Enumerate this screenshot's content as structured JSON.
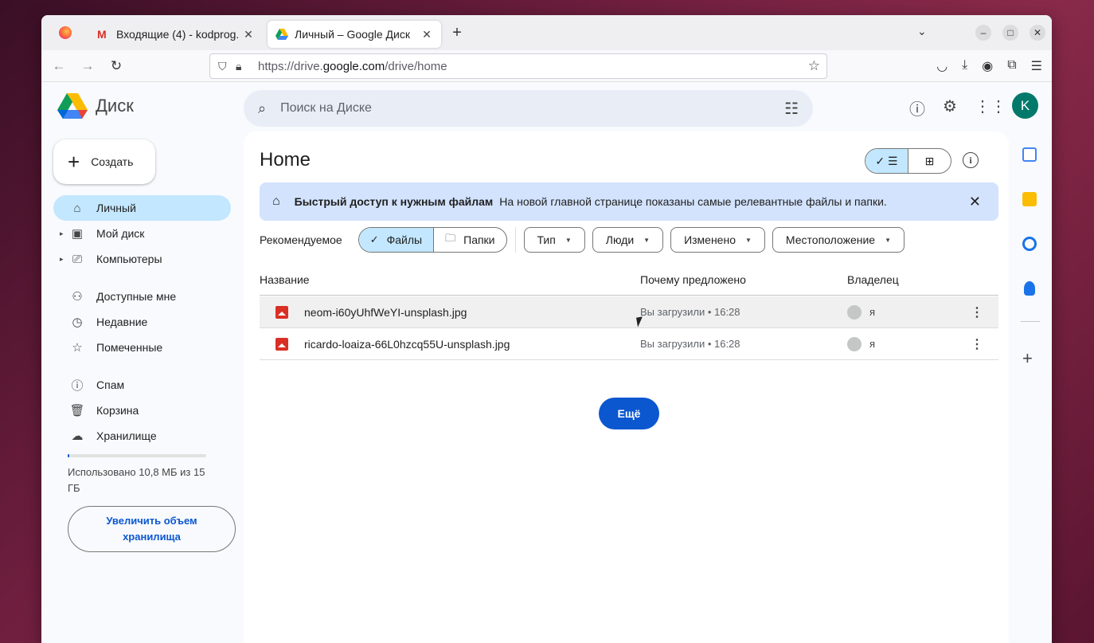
{
  "browser": {
    "tabs": [
      {
        "title": "Входящие (4) - kodprog.",
        "icon": "gmail-icon"
      },
      {
        "title": "Личный – Google Диск",
        "icon": "google-drive-icon",
        "active": true
      }
    ],
    "url_prefix": "https://drive.",
    "url_domain": "google.com",
    "url_path": "/drive/home"
  },
  "app": {
    "logo_text": "Диск",
    "search_placeholder": "Поиск на Диске",
    "avatar_letter": "K"
  },
  "sidebar": {
    "create_label": "Создать",
    "items": [
      {
        "label": "Личный",
        "icon": "home-icon",
        "active": true
      },
      {
        "label": "Мой диск",
        "icon": "my-drive-icon",
        "expandable": true
      },
      {
        "label": "Компьютеры",
        "icon": "computers-icon",
        "expandable": true
      },
      {
        "label": "Доступные мне",
        "icon": "shared-icon"
      },
      {
        "label": "Недавние",
        "icon": "clock-icon"
      },
      {
        "label": "Помеченные",
        "icon": "star-icon"
      },
      {
        "label": "Спам",
        "icon": "spam-icon"
      },
      {
        "label": "Корзина",
        "icon": "trash-icon"
      },
      {
        "label": "Хранилище",
        "icon": "cloud-icon"
      }
    ],
    "storage_used_fraction": 0.0007,
    "storage_text": "Использовано 10,8 МБ из 15 ГБ",
    "upgrade_label": "Увеличить объем хранилища"
  },
  "main": {
    "title": "Home",
    "banner": {
      "title": "Быстрый доступ к нужным файлам",
      "text": "На новой главной странице показаны самые релевантные файлы и папки."
    },
    "filters": {
      "label": "Рекомендуемое",
      "segments": [
        "Файлы",
        "Папки"
      ],
      "chips": [
        "Тип",
        "Люди",
        "Изменено",
        "Местоположение"
      ]
    },
    "columns": [
      "Название",
      "Почему предложено",
      "Владелец"
    ],
    "files": [
      {
        "name": "neom-i60yUhfWeYI-unsplash.jpg",
        "reason": "Вы загрузили • 16:28",
        "owner": "я"
      },
      {
        "name": "ricardo-loaiza-66L0hzcq55U-unsplash.jpg",
        "reason": "Вы загрузили • 16:28",
        "owner": "я"
      }
    ],
    "more_label": "Ещё"
  },
  "colors": {
    "accent": "#0b57d0",
    "selected": "#c2e7ff",
    "banner": "#d3e3fd"
  }
}
